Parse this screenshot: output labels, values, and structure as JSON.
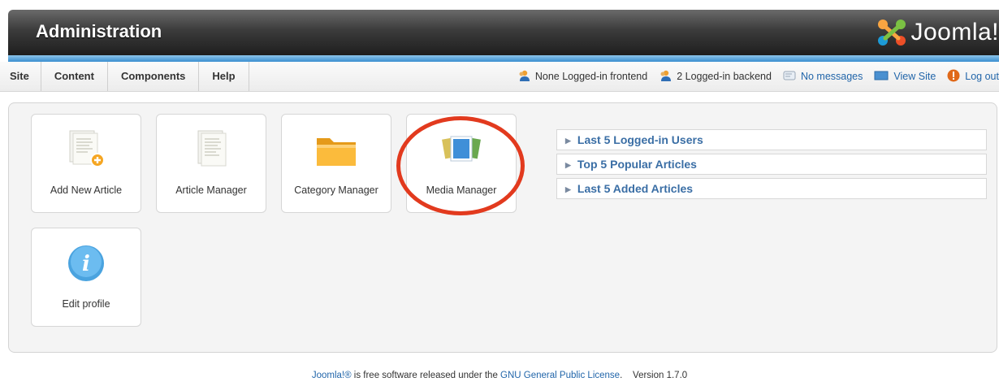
{
  "header": {
    "title": "Administration",
    "logo_text": "Joomla!"
  },
  "menu": {
    "items": [
      {
        "label": "Site"
      },
      {
        "label": "Content"
      },
      {
        "label": "Components"
      },
      {
        "label": "Help"
      }
    ]
  },
  "status": {
    "frontend": "None Logged-in frontend",
    "backend": "2 Logged-in backend",
    "messages": "No messages",
    "view_site": "View Site",
    "logout": "Log out"
  },
  "quickicons": [
    {
      "label": "Add New Article",
      "icon": "add-article-icon"
    },
    {
      "label": "Article Manager",
      "icon": "article-icon"
    },
    {
      "label": "Category Manager",
      "icon": "folder-icon"
    },
    {
      "label": "Media Manager",
      "icon": "media-icon"
    },
    {
      "label": "Edit profile",
      "icon": "info-icon"
    }
  ],
  "modules": [
    {
      "label": "Last 5 Logged-in Users"
    },
    {
      "label": "Top 5 Popular Articles"
    },
    {
      "label": "Last 5 Added Articles"
    }
  ],
  "footer": {
    "brand": "Joomla!®",
    "text": " is free software released under the ",
    "license": "GNU General Public License",
    "version": ".    Version 1.7.0"
  },
  "colors": {
    "accent": "#3b8fd0",
    "highlight_circle": "#e23a1e",
    "link": "#2266aa"
  }
}
